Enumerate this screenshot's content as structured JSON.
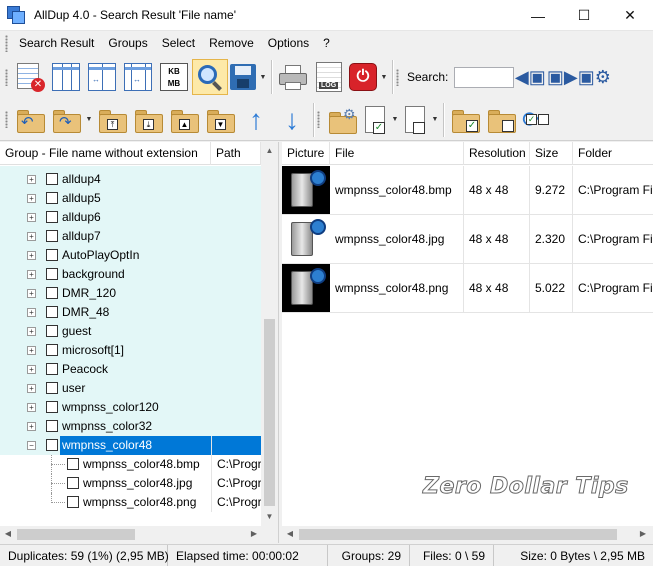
{
  "window": {
    "title": "AllDup 4.0 - Search Result 'File name'",
    "minimize": "—",
    "maximize": "☐",
    "close": "✕"
  },
  "menu": [
    "Search Result",
    "Groups",
    "Select",
    "Remove",
    "Options",
    "?"
  ],
  "toolbar": {
    "search_label": "Search:",
    "search_value": "",
    "kb_line1": "KB",
    "kb_line2": "MB",
    "log_label": "LOG"
  },
  "left_pane": {
    "columns": [
      "Group - File name without extension",
      "Path"
    ],
    "groups": [
      {
        "label": "alldup4"
      },
      {
        "label": "alldup5"
      },
      {
        "label": "alldup6"
      },
      {
        "label": "alldup7"
      },
      {
        "label": "AutoPlayOptIn"
      },
      {
        "label": "background"
      },
      {
        "label": "DMR_120"
      },
      {
        "label": "DMR_48"
      },
      {
        "label": "guest"
      },
      {
        "label": "microsoft[1]"
      },
      {
        "label": "Peacock"
      },
      {
        "label": "user"
      },
      {
        "label": "wmpnss_color120"
      },
      {
        "label": "wmpnss_color32"
      },
      {
        "label": "wmpnss_color48"
      }
    ],
    "children": [
      {
        "label": "wmpnss_color48.bmp",
        "path": "C:\\Progr"
      },
      {
        "label": "wmpnss_color48.jpg",
        "path": "C:\\Progr"
      },
      {
        "label": "wmpnss_color48.png",
        "path": "C:\\Progr"
      }
    ]
  },
  "right_pane": {
    "columns": [
      "Picture",
      "File",
      "Resolution",
      "Size",
      "Folder"
    ],
    "rows": [
      {
        "file": "wmpnss_color48.bmp",
        "resolution": "48 x 48",
        "size": "9.272",
        "folder": "C:\\Program Fi"
      },
      {
        "file": "wmpnss_color48.jpg",
        "resolution": "48 x 48",
        "size": "2.320",
        "folder": "C:\\Program Fi"
      },
      {
        "file": "wmpnss_color48.png",
        "resolution": "48 x 48",
        "size": "5.022",
        "folder": "C:\\Program Fi"
      }
    ]
  },
  "watermark": "Zero Dollar Tips",
  "status": {
    "duplicates": "Duplicates: 59 (1%) (2,95 MB)",
    "elapsed": "Elapsed time: 00:00:02",
    "groups": "Groups: 29",
    "files": "Files: 0 \\ 59",
    "size": "Size: 0 Bytes \\ 2,95 MB"
  },
  "colors": {
    "selection": "#0078d7",
    "group_row_bg": "#e3f7f7",
    "active_tool_bg": "#fde9a8"
  }
}
